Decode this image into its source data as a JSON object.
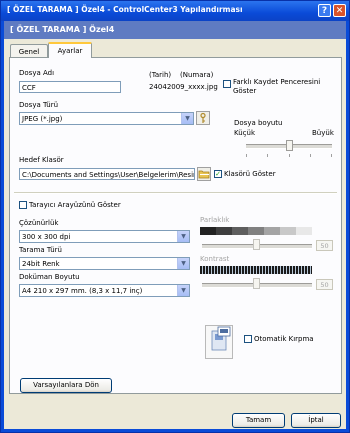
{
  "window": {
    "title": "[ ÖZEL TARAMA ]  Özel4 - ControlCenter3 Yapılandırması",
    "banner": "[ ÖZEL TARAMA ]  Özel4",
    "help_glyph": "?",
    "close_glyph": "✕"
  },
  "tabs": [
    {
      "label": "Genel",
      "active": false
    },
    {
      "label": "Ayarlar",
      "active": true
    }
  ],
  "file": {
    "name_label": "Dosya Adı",
    "name_value": "CCF",
    "date_label": "(Tarih)",
    "number_label": "(Numara)",
    "example": "24042009_xxxx.jpg",
    "diff_save_label": "Farklı Kaydet Penceresini Göster",
    "diff_save_checked": false,
    "type_label": "Dosya Türü",
    "type_value": "JPEG (*.jpg)",
    "size_label": "Dosya boyutu",
    "size_small": "Küçük",
    "size_large": "Büyük",
    "size_level": 0.5,
    "target_label": "Hedef Klasör",
    "target_value": "C:\\Documents and Settings\\User\\Belgelerim\\Resimler",
    "show_folder_label": "Klasörü Göster",
    "show_folder_checked": true
  },
  "scanner": {
    "show_ui_label": "Tarayıcı Arayüzünü Göster",
    "show_ui_checked": false,
    "resolution_label": "Çözünürlük",
    "resolution_value": "300 x 300 dpi",
    "scan_type_label": "Tarama Türü",
    "scan_type_value": "24bit Renk",
    "doc_size_label": "Doküman Boyutu",
    "doc_size_value": "A4 210 x 297 mm. (8,3 x 11,7 inç)",
    "brightness_label": "Parlaklık",
    "brightness_value": "50",
    "contrast_label": "Kontrast",
    "contrast_value": "50",
    "autocrop_label": "Otomatik Kırpma",
    "autocrop_checked": false
  },
  "buttons": {
    "defaults": "Varsayılanlara Dön",
    "ok": "Tamam",
    "cancel": "İptal"
  },
  "icons": {
    "file_type_settings": "key-settings-icon",
    "browse_folder": "folder-browse-icon",
    "autocrop": "autocrop-document-icon"
  },
  "colors": {
    "titlebar": "#0a4bd8",
    "banner": "#5f7bc2",
    "panel": "#fcfcfe",
    "dialog": "#ece9d8"
  }
}
